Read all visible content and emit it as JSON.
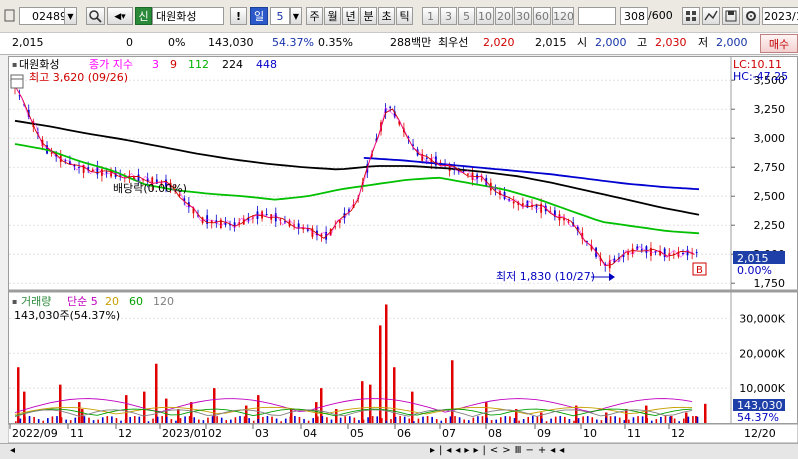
{
  "toolbar": {
    "code": "024890",
    "market_badge": "신",
    "name": "대원화성",
    "period_label": "일",
    "period_n": "5",
    "periods": [
      "주",
      "월",
      "년",
      "분",
      "초",
      "틱"
    ],
    "minute_options": [
      "1",
      "3",
      "5",
      "10",
      "20",
      "30",
      "60",
      "120"
    ],
    "range": "308",
    "range_total": "/600",
    "date": "2023/1"
  },
  "quote": {
    "price": "2,015",
    "change": "0",
    "change_rate": "0%",
    "volume": "143,030",
    "volume_rate": "54.37%",
    "turnover": "0.35%",
    "amount": "288백만",
    "priority_label": "최우선",
    "priority_ask": "2,020",
    "priority_bid": "2,015",
    "open_label": "시",
    "open": "2,000",
    "high_label": "고",
    "high": "2,030",
    "low_label": "저",
    "low": "2,000",
    "buy_button": "매수"
  },
  "price_panel": {
    "title": "대원화성",
    "legend_label": "종가 지수",
    "ma": [
      {
        "label": "3",
        "color": "#ff00ff"
      },
      {
        "label": "9",
        "color": "#d40000"
      },
      {
        "label": "112",
        "color": "#00b000"
      },
      {
        "label": "224",
        "color": "#000000"
      },
      {
        "label": "448",
        "color": "#0000c8"
      }
    ],
    "lc": "LC:10.11",
    "hc": "HC:-47.25",
    "max_note": "최고 3,620 (09/26)",
    "min_note": "최저 1,830 (10/27)",
    "dividend_note": "배당락(0.00%)",
    "cur_price": "2,015",
    "cur_rate": "0.00%",
    "badge": "B",
    "y_ticks": [
      "3,500",
      "3,250",
      "3,000",
      "2,750",
      "2,500",
      "2,250",
      "2,000",
      "1,750"
    ]
  },
  "volume_panel": {
    "title": "거래량",
    "legend": [
      {
        "label": "단순 5",
        "color": "#c000c0"
      },
      {
        "label": "20",
        "color": "#c8a000"
      },
      {
        "label": "60",
        "color": "#00a000"
      },
      {
        "label": "120",
        "color": "#808080"
      }
    ],
    "sub": "143,030주(54.37%)",
    "y_ticks": [
      "30,000K",
      "20,000K",
      "10,000K"
    ],
    "cur_vol": "143,030",
    "cur_rate": "54.37%"
  },
  "x_axis": [
    "2022/09",
    "11",
    "12",
    "2023/01",
    "02",
    "03",
    "04",
    "05",
    "06",
    "07",
    "08",
    "09",
    "10",
    "11",
    "12"
  ],
  "x_axis_right": "12/20",
  "chart_data": {
    "type": "line",
    "title": "대원화성",
    "series": [
      {
        "name": "종가",
        "values": [
          3450,
          2900,
          2750,
          2700,
          2650,
          2600,
          2300,
          2250,
          2350,
          2250,
          2150,
          2450,
          3300,
          2850,
          2750,
          2650,
          2450,
          2400,
          2250,
          1900,
          2050,
          2000,
          2015
        ]
      },
      {
        "name": "112",
        "values": [
          2950,
          2900,
          2800,
          2720,
          2600,
          2550,
          2520,
          2500,
          2470,
          2500,
          2560,
          2600,
          2640,
          2660,
          2610,
          2560,
          2480,
          2380,
          2280,
          2240,
          2200,
          2180
        ]
      },
      {
        "name": "224",
        "values": [
          3150,
          3100,
          3040,
          2990,
          2930,
          2870,
          2820,
          2780,
          2750,
          2730,
          2760,
          2760,
          2740,
          2710,
          2670,
          2610,
          2540,
          2470,
          2400,
          2340
        ]
      },
      {
        "name": "448",
        "values": [
          2830,
          2810,
          2780,
          2750,
          2720,
          2690,
          2650,
          2610,
          2580,
          2560
        ]
      }
    ],
    "volume_values_k": [
      16000,
      9000,
      11000,
      6000,
      4000,
      8000,
      9000,
      17000,
      7000,
      4000,
      6000,
      10000,
      5000,
      8000,
      4000,
      6000,
      10000,
      4000,
      12000,
      11000,
      28000,
      34000,
      16000,
      9000,
      18000,
      6000,
      4000,
      3000,
      5000,
      3000,
      4000,
      5000,
      2000,
      3000,
      2000,
      5500
    ],
    "ylim": [
      1700,
      3700
    ],
    "volume_ylim": [
      0,
      35000
    ]
  }
}
